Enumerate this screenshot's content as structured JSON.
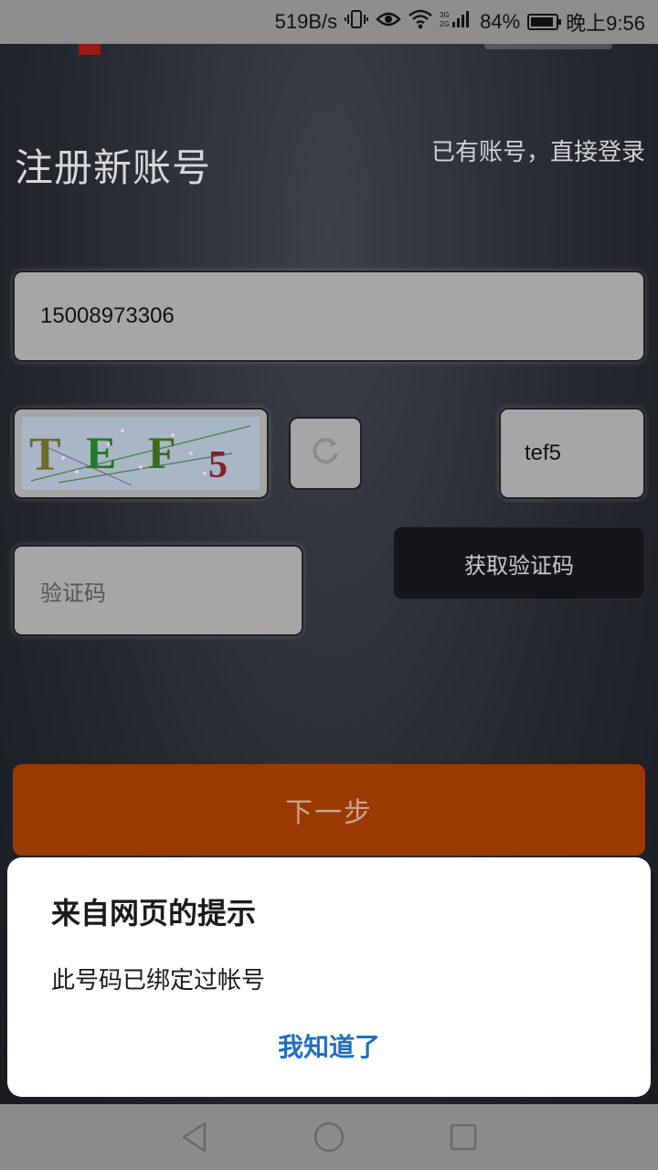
{
  "status_bar": {
    "net_speed": "519B/s",
    "battery_percent": "84%",
    "time": "晚上9:56",
    "icons": [
      "vibrate-icon",
      "eye-icon",
      "wifi-icon",
      "signal-icon",
      "battery-icon"
    ]
  },
  "header": {
    "title": "注册新账号",
    "login_link": "已有账号，直接登录"
  },
  "form": {
    "phone_value": "15008973306",
    "captcha_image_text": "TEF5",
    "captcha_input_value": "tef5",
    "code_placeholder": "验证码",
    "get_code_label": "获取验证码",
    "next_label": "下一步"
  },
  "dialog": {
    "title": "来自网页的提示",
    "message": "此号码已绑定过帐号",
    "confirm_label": "我知道了"
  },
  "navbar": {
    "icons": [
      "back-icon",
      "home-icon",
      "recents-icon"
    ]
  },
  "colors": {
    "accent_orange": "#9a3a00",
    "dialog_button_blue": "#1f6fc0",
    "field_gray": "#a6a6a6"
  }
}
